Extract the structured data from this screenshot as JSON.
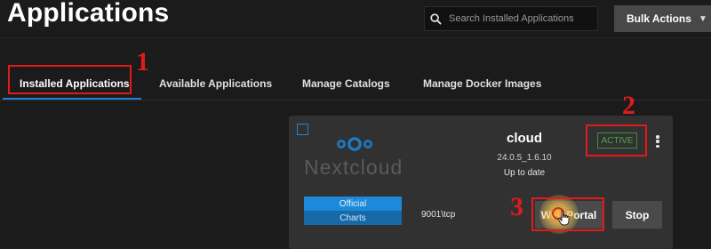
{
  "page": {
    "title": "Applications"
  },
  "search": {
    "placeholder": "Search Installed Applications",
    "icon": "search-icon"
  },
  "bulk_actions": {
    "label": "Bulk Actions",
    "icon": "caret-down-icon"
  },
  "tabs": [
    {
      "label": "Installed Applications",
      "active": true
    },
    {
      "label": "Available Applications",
      "active": false
    },
    {
      "label": "Manage Catalogs",
      "active": false
    },
    {
      "label": "Manage Docker Images",
      "active": false
    }
  ],
  "annotations": [
    "1",
    "2",
    "3"
  ],
  "app_card": {
    "logo_text": "Nextcloud",
    "name": "cloud",
    "version": "24.0.5_1.6.10",
    "update_status": "Up to date",
    "state": "ACTIVE",
    "chips": [
      "Official",
      "Charts"
    ],
    "port": "9001\\tcp",
    "web_portal_label": "Web Portal",
    "stop_label": "Stop"
  },
  "colors": {
    "background": "#1b1b1b",
    "card": "#313131",
    "accent_blue": "#1f7fd4",
    "active_green": "#4ea84a",
    "annotation_red": "#e11b1b"
  }
}
